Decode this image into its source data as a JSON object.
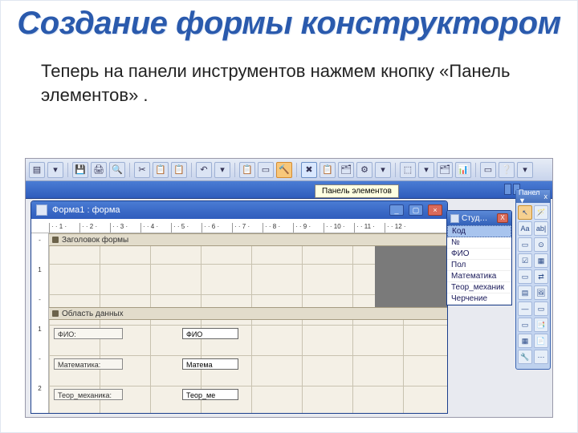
{
  "slide": {
    "title": "Создание формы конструктором",
    "body_prefix": "Теперь на панели инструментов нажмем кнопку «",
    "body_quoted": "Панель элементов",
    "body_suffix": "» ."
  },
  "tooltip": {
    "text": "Панель элементов"
  },
  "form_window": {
    "title": "Форма1 : форма",
    "ruler_marks": [
      "1",
      "2",
      "3",
      "4",
      "5",
      "6",
      "7",
      "8",
      "9",
      "10",
      "11",
      "12"
    ],
    "vruler_marks": [
      "-",
      "1",
      "-",
      "1",
      "-",
      "2"
    ],
    "section_header": "Заголовок формы",
    "section_detail": "Область данных",
    "fields": [
      {
        "label": "ФИО:",
        "bound": "ФИО"
      },
      {
        "label": "Математика:",
        "bound": "Матема"
      },
      {
        "label": "Теор_механика:",
        "bound": "Теор_ме"
      }
    ]
  },
  "fieldlist": {
    "title": "Студ…",
    "items": [
      "Код",
      "№",
      "ФИО",
      "Пол",
      "Математика",
      "Теор_механик",
      "Черчение"
    ],
    "selected_index": 0
  },
  "toolbox": {
    "title": "Панел ▼",
    "close": "x",
    "icons": [
      "↖",
      "🪄",
      "Aa",
      "ab|",
      "▭",
      "⊙",
      "☑",
      "▦",
      "▭",
      "⇄",
      "▤",
      "🖼",
      "—",
      "▭",
      "▭",
      "📑",
      "▦",
      "📄",
      "🔧",
      "⋯"
    ]
  },
  "toolbar": {
    "icons": [
      "▤",
      "▾",
      "💾",
      "🖨",
      "🔍",
      "✂",
      "📋",
      "📋",
      "↶",
      "▾",
      "📋",
      "▭",
      "🔨",
      "✖",
      "📋",
      "🗂",
      "⚙",
      "▾",
      "⬚",
      "▾",
      "🗂",
      "📊",
      "▭",
      "❔",
      "▾"
    ]
  }
}
